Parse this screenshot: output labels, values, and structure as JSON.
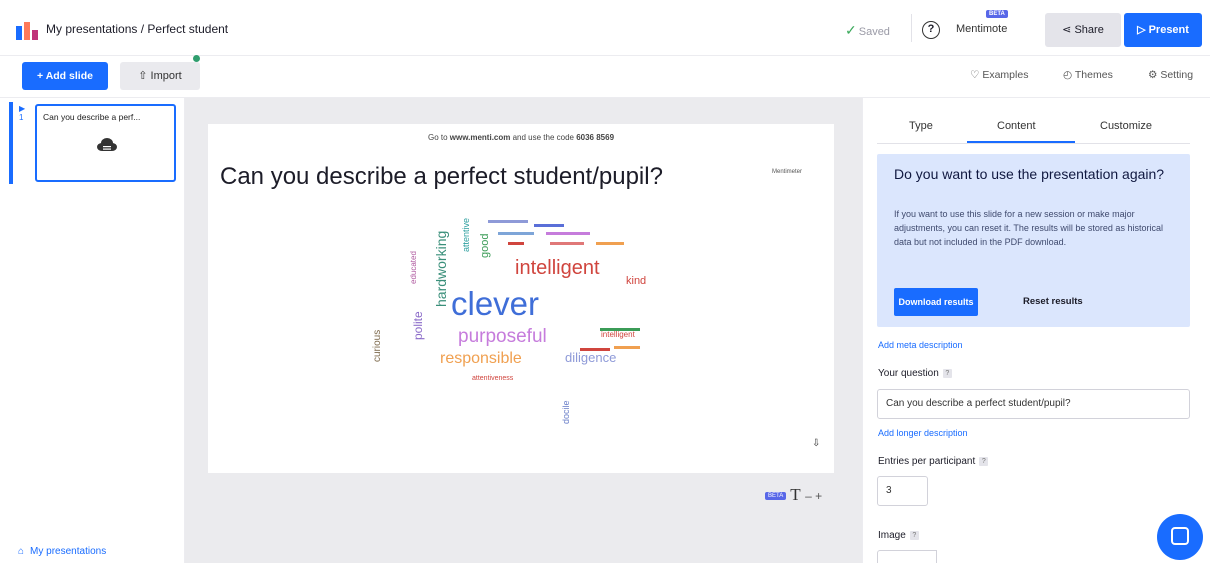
{
  "header": {
    "breadcrumb_root": "My presentations",
    "breadcrumb_sep": " / ",
    "breadcrumb_current": "Perfect student",
    "saved_label": "Saved",
    "help_label": "?",
    "brand_label": "Mentimote",
    "beta_badge": "BETA",
    "share_label": "Share",
    "present_label": "Present"
  },
  "toolbar": {
    "add_slide_label": "+ Add slide",
    "import_label": "Import",
    "examples_label": "Examples",
    "themes_label": "Themes",
    "settings_label": "Setting"
  },
  "slides_panel": {
    "slides": [
      {
        "number": "1",
        "title": "Can you describe a perf..."
      }
    ],
    "my_presentations_label": "My presentations"
  },
  "slide": {
    "instruction_prefix": "Go to ",
    "instruction_url": "www.menti.com",
    "instruction_mid": " and use the code ",
    "instruction_code": "6036 8569",
    "question": "Can you describe a perfect student/pupil?",
    "brand_mark": "Mentimeter",
    "wordcloud": {
      "w_clever": "clever",
      "w_intelligent": "intelligent",
      "w_purposeful": "purposeful",
      "w_responsible": "responsible",
      "w_diligence": "diligence",
      "w_hardworking": "hardworking",
      "w_polite": "polite",
      "w_curious": "curious",
      "w_good": "good",
      "w_attentive": "attentive",
      "w_kind": "kind",
      "w_intelligent2": "intelligent",
      "w_docile": "docile",
      "w_educated": "educated",
      "w_attentiveness": "attentiveness"
    }
  },
  "canvas_tools": {
    "badge": "BETA",
    "text_tool": "T",
    "zoom": "– +"
  },
  "editor": {
    "tabs": [
      "Type",
      "Content",
      "Customize"
    ],
    "info": {
      "title": "Do you want to use the presentation again?",
      "body": "If you want to use this slide for a new session or make major adjustments, you can reset it. The results will be stored as historical data but not included in the PDF download.",
      "download_label": "Download results",
      "reset_label": "Reset results"
    },
    "add_meta_label": "Add meta description",
    "question_label": "Your question",
    "question_value": "Can you describe a perfect student/pupil?",
    "add_longer_label": "Add longer description",
    "entries_label": "Entries per participant",
    "entries_value": "3",
    "image_label": "Image",
    "help_mark": "?"
  }
}
